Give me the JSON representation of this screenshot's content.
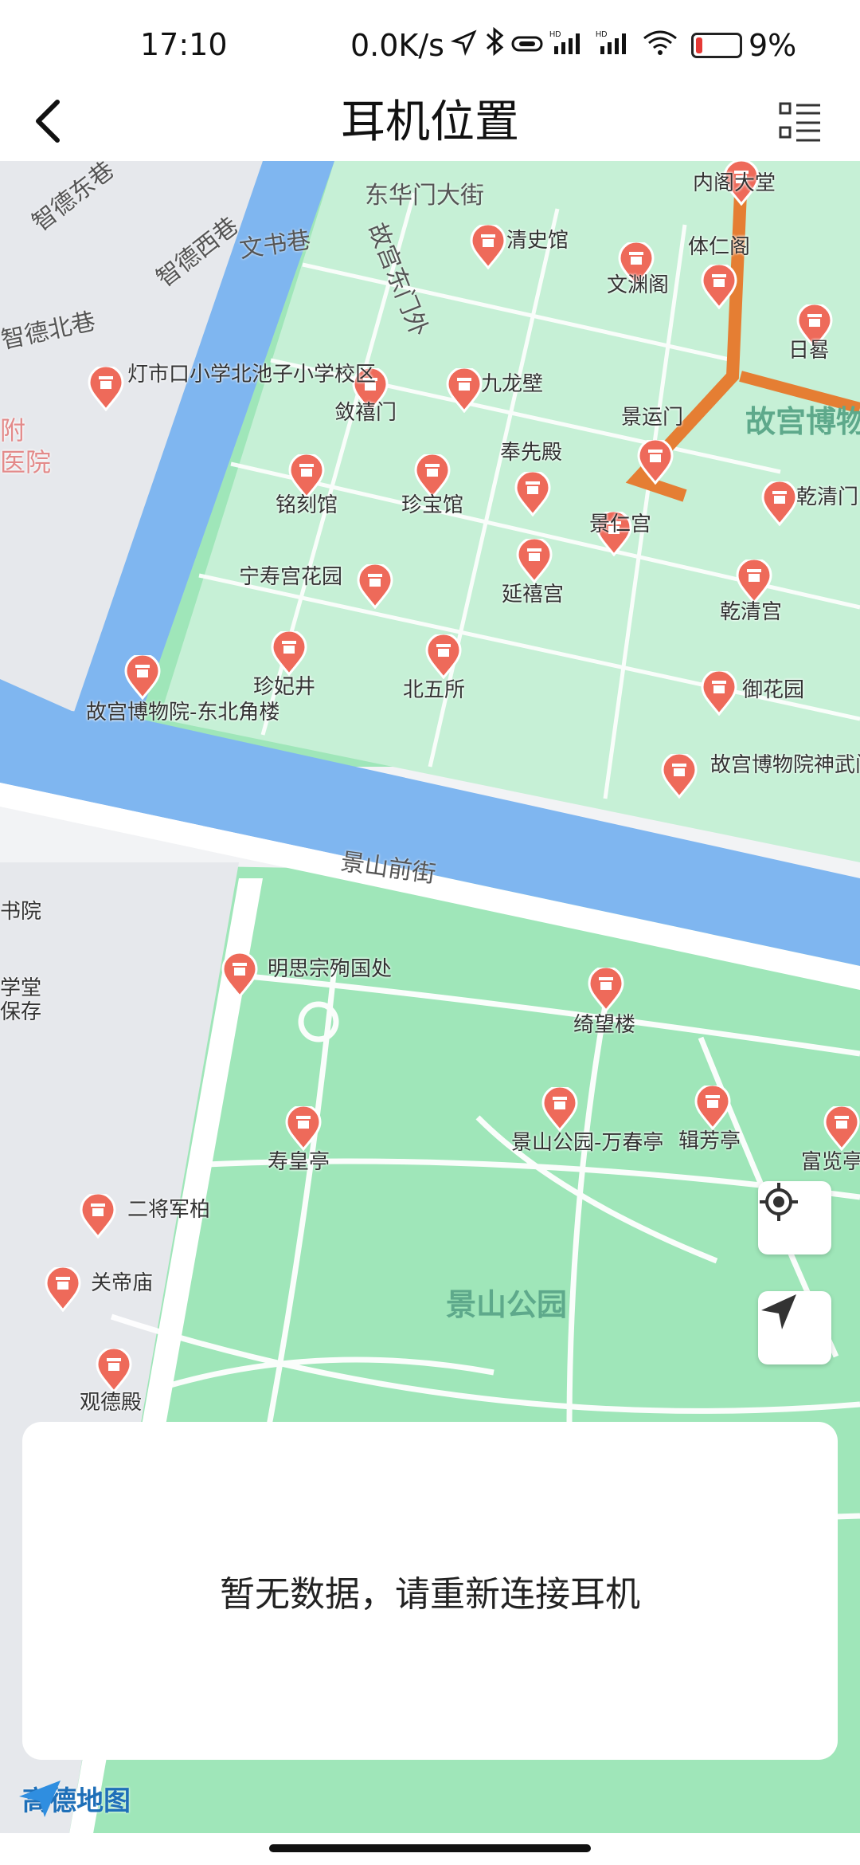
{
  "status_bar": {
    "time": "17:10",
    "network_speed": "0.0K/s",
    "battery": "9%",
    "icons": [
      "location-arrow-icon",
      "bluetooth-icon",
      "link-icon",
      "hd-signal-icon",
      "hd-signal-icon",
      "wifi-icon",
      "battery-icon"
    ]
  },
  "header": {
    "title": "耳机位置",
    "back_icon": "chevron-left-icon",
    "menu_icon": "list-icon"
  },
  "map": {
    "streets": [
      "东华门大街",
      "故宫东门外",
      "智德北巷",
      "文书巷",
      "智德东巷",
      "智德西巷",
      "景山前街"
    ],
    "area_labels": [
      "故宫博物",
      "景山公园"
    ],
    "pois": [
      {
        "name": "清史馆"
      },
      {
        "name": "文渊阁"
      },
      {
        "name": "内阁大堂"
      },
      {
        "name": "体仁阁"
      },
      {
        "name": "日晷"
      },
      {
        "name": "九龙壁"
      },
      {
        "name": "敛禧门"
      },
      {
        "name": "灯市口小学北池子小学校区"
      },
      {
        "name": "景运门"
      },
      {
        "name": "奉先殿"
      },
      {
        "name": "铭刻馆"
      },
      {
        "name": "珍宝馆"
      },
      {
        "name": "乾清门"
      },
      {
        "name": "景仁宫"
      },
      {
        "name": "宁寿宫花园"
      },
      {
        "name": "延禧宫"
      },
      {
        "name": "乾清宫"
      },
      {
        "name": "珍妃井"
      },
      {
        "name": "北五所"
      },
      {
        "name": "御花园"
      },
      {
        "name": "故宫博物院-东北角楼"
      },
      {
        "name": "故宫博物院神武门"
      },
      {
        "name": "明思宗殉国处"
      },
      {
        "name": "绮望楼"
      },
      {
        "name": "寿皇亭"
      },
      {
        "name": "景山公园-万春亭"
      },
      {
        "name": "辑芳亭"
      },
      {
        "name": "富览亭"
      },
      {
        "name": "二将军柏"
      },
      {
        "name": "关帝庙"
      },
      {
        "name": "观德殿"
      }
    ],
    "side_labels": [
      "书院",
      "学堂",
      "保存",
      "医院",
      "附"
    ],
    "locate_icon": "crosshair-icon",
    "navigate_icon": "navigation-arrow-icon",
    "logo_text": "高德地图"
  },
  "panel": {
    "message": "暂无数据，请重新连接耳机"
  },
  "colors": {
    "map_green": "#9fe6b9",
    "water": "#7fb6f0",
    "poi_red": "#ee6a5a",
    "palace_wall": "#e57e33"
  }
}
